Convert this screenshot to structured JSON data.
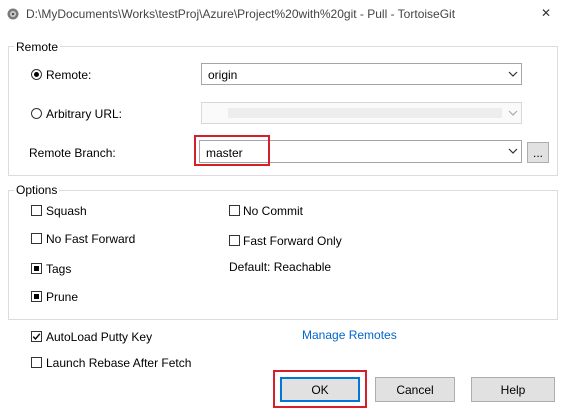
{
  "window": {
    "title": "D:\\MyDocuments\\Works\\testProj\\Azure\\Project%20with%20git - Pull - TortoiseGit",
    "close_glyph": "✕"
  },
  "remote_group": {
    "title": "Remote",
    "remote_label": "Remote:",
    "remote_value": "origin",
    "arbitrary_label": "Arbitrary URL:",
    "arbitrary_value": "",
    "branch_label": "Remote Branch:",
    "branch_value": "master",
    "browse_label": "..."
  },
  "options_group": {
    "title": "Options",
    "squash": "Squash",
    "no_commit": "No Commit",
    "no_fast_forward": "No Fast Forward",
    "fast_forward_only": "Fast Forward Only",
    "tags": "Tags",
    "default_reachable": "Default: Reachable",
    "prune": "Prune"
  },
  "extras": {
    "autoload_putty": "AutoLoad Putty Key",
    "manage_remotes": "Manage Remotes",
    "launch_rebase": "Launch Rebase After Fetch"
  },
  "buttons": {
    "ok": "OK",
    "cancel": "Cancel",
    "help": "Help"
  },
  "colors": {
    "highlight_box": "#d61f2b",
    "link": "#0066cc",
    "default_button_border": "#0078d7"
  }
}
